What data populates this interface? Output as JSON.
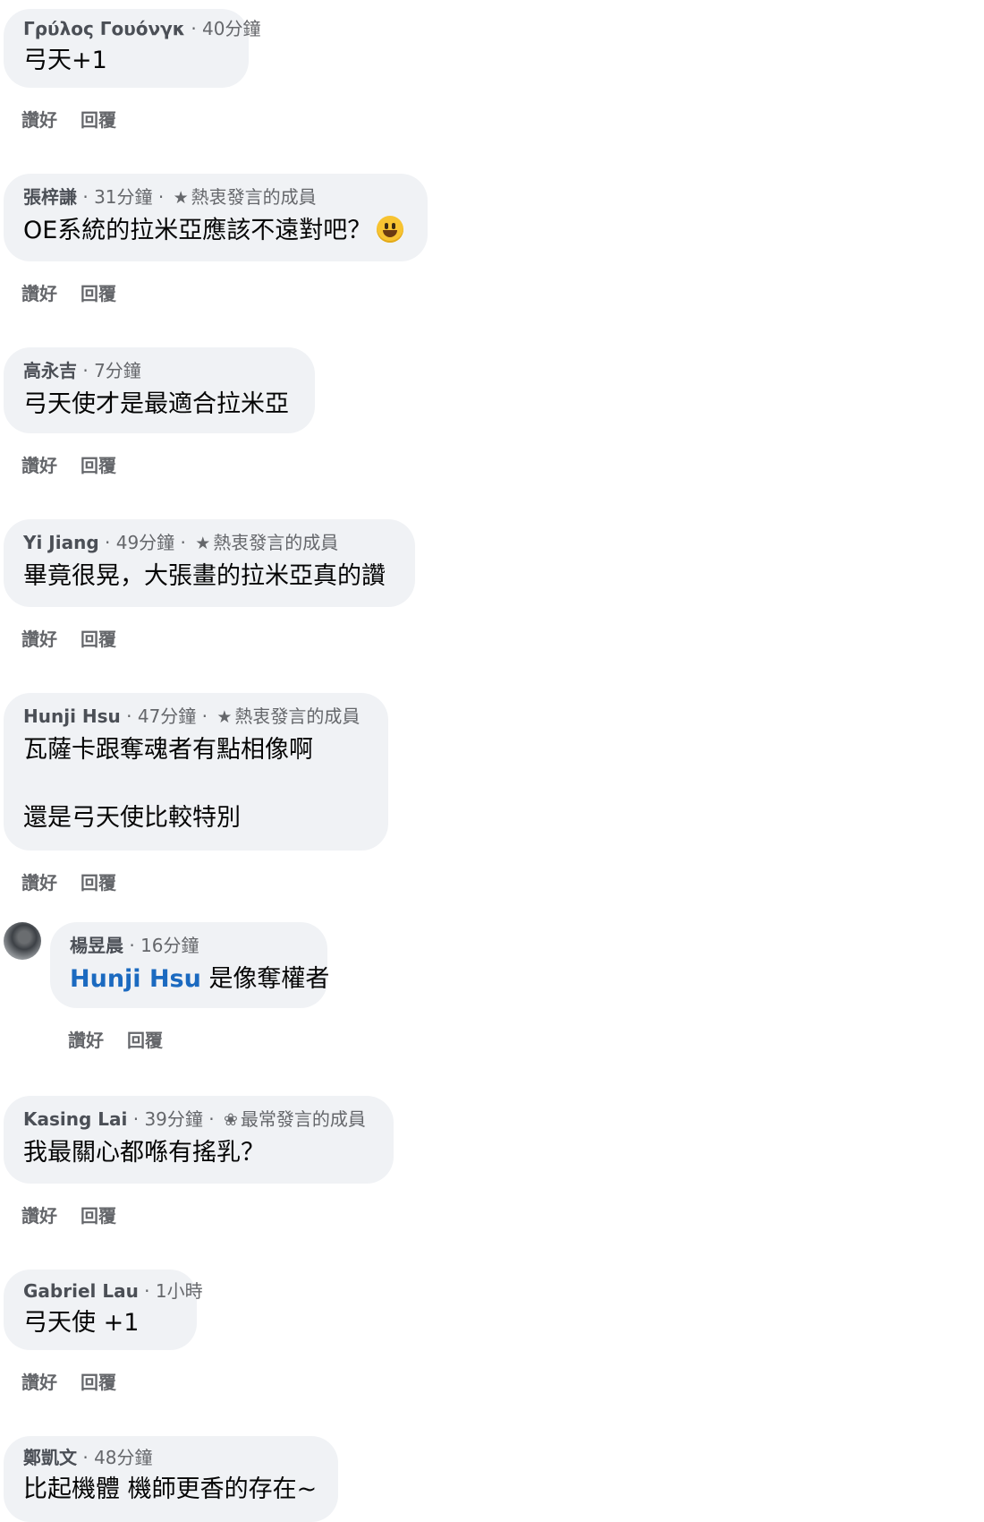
{
  "comments": [
    {
      "author": "Γρύλος Γουόνγκ",
      "time": "40分鐘",
      "badge": "",
      "lines": [
        "弓天+1"
      ],
      "emoji": false,
      "like": "讚好",
      "reply": "回覆"
    },
    {
      "author": "張梓謙",
      "time": "31分鐘",
      "badge": "熱衷發言的成員",
      "lines": [
        "OE系統的拉米亞應該不遠對吧？"
      ],
      "emoji": true,
      "like": "讚好",
      "reply": "回覆"
    },
    {
      "author": "高永吉",
      "time": "7分鐘",
      "badge": "",
      "lines": [
        "弓天使才是最適合拉米亞"
      ],
      "emoji": false,
      "like": "讚好",
      "reply": "回覆"
    },
    {
      "author": "Yi Jiang",
      "time": "49分鐘",
      "badge": "熱衷發言的成員",
      "lines": [
        "畢竟很晃，大張畫的拉米亞真的讚"
      ],
      "emoji": false,
      "like": "讚好",
      "reply": "回覆"
    },
    {
      "author": "Hunji Hsu",
      "time": "47分鐘",
      "badge": "熱衷發言的成員",
      "lines": [
        "瓦薩卡跟奪魂者有點相像啊",
        "還是弓天使比較特別"
      ],
      "emoji": false,
      "like": "讚好",
      "reply": "回覆"
    }
  ],
  "reply": {
    "author": "楊昱晨",
    "time": "16分鐘",
    "mention": "Hunji Hsu",
    "text": "是像奪權者",
    "like": "讚好",
    "reply": "回覆"
  },
  "comments2": [
    {
      "author": "Kasing Lai",
      "time": "39分鐘",
      "badge": "最常發言的成員",
      "lines": [
        "我最關心都喺有搖乳？"
      ],
      "like": "讚好",
      "reply": "回覆"
    },
    {
      "author": "Gabriel Lau",
      "time": "1小時",
      "badge": "",
      "lines": [
        "弓天使 +1"
      ],
      "like": "讚好",
      "reply": "回覆"
    },
    {
      "author": "鄭凱文",
      "time": "48分鐘",
      "badge": "",
      "lines": [
        "比起機體 機師更香的存在~"
      ],
      "like": "",
      "reply": ""
    }
  ],
  "icons": {
    "badge_star": "star-icon",
    "badge_top": "award-icon",
    "emoji": "grinning-face-emoji"
  }
}
